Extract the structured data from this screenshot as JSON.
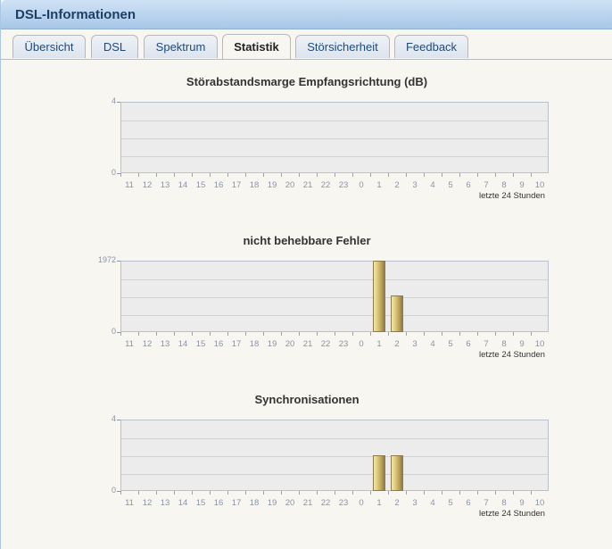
{
  "window": {
    "title": "DSL-Informationen"
  },
  "tabs": [
    {
      "label": "Übersicht"
    },
    {
      "label": "DSL"
    },
    {
      "label": "Spektrum"
    },
    {
      "label": "Statistik",
      "active": true
    },
    {
      "label": "Störsicherheit"
    },
    {
      "label": "Feedback"
    }
  ],
  "colors": {
    "bar": "#c9b46a",
    "plot_bg": "#ececec",
    "title_blue": "#1d3f66"
  },
  "chart_data": [
    {
      "type": "bar",
      "title": "Störabstandsmarge Empfangsrichtung (dB)",
      "categories": [
        "11",
        "12",
        "13",
        "14",
        "15",
        "16",
        "17",
        "18",
        "19",
        "20",
        "21",
        "22",
        "23",
        "0",
        "1",
        "2",
        "3",
        "4",
        "5",
        "6",
        "7",
        "8",
        "9",
        "10"
      ],
      "values": [
        0,
        0,
        0,
        0,
        0,
        0,
        0,
        0,
        0,
        0,
        0,
        0,
        0,
        0,
        0,
        0,
        0,
        0,
        0,
        0,
        0,
        0,
        0,
        0
      ],
      "ylim": [
        0,
        4
      ],
      "ytick_labels": [
        "4",
        "0"
      ],
      "xlabel": "letzte 24 Stunden",
      "grid": true
    },
    {
      "type": "bar",
      "title": "nicht behebbare Fehler",
      "categories": [
        "11",
        "12",
        "13",
        "14",
        "15",
        "16",
        "17",
        "18",
        "19",
        "20",
        "21",
        "22",
        "23",
        "0",
        "1",
        "2",
        "3",
        "4",
        "5",
        "6",
        "7",
        "8",
        "9",
        "10"
      ],
      "values": [
        0,
        0,
        0,
        0,
        0,
        0,
        0,
        0,
        0,
        0,
        0,
        0,
        0,
        0,
        1972,
        1000,
        0,
        0,
        0,
        0,
        0,
        0,
        0,
        0
      ],
      "ylim": [
        0,
        1972
      ],
      "ytick_labels": [
        "1972",
        "0"
      ],
      "xlabel": "letzte 24 Stunden",
      "grid": true
    },
    {
      "type": "bar",
      "title": "Synchronisationen",
      "categories": [
        "11",
        "12",
        "13",
        "14",
        "15",
        "16",
        "17",
        "18",
        "19",
        "20",
        "21",
        "22",
        "23",
        "0",
        "1",
        "2",
        "3",
        "4",
        "5",
        "6",
        "7",
        "8",
        "9",
        "10"
      ],
      "values": [
        0,
        0,
        0,
        0,
        0,
        0,
        0,
        0,
        0,
        0,
        0,
        0,
        0,
        0,
        2,
        2,
        0,
        0,
        0,
        0,
        0,
        0,
        0,
        0
      ],
      "ylim": [
        0,
        4
      ],
      "ytick_labels": [
        "4",
        "0"
      ],
      "xlabel": "letzte 24 Stunden",
      "grid": true
    }
  ]
}
